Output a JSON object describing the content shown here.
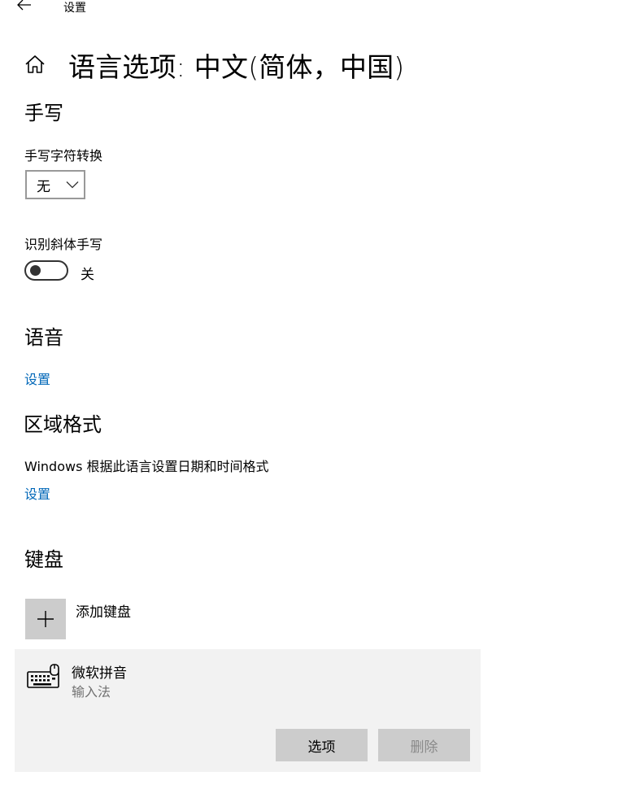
{
  "window": {
    "title": "设置",
    "back_icon": "back-arrow-icon"
  },
  "header": {
    "home_icon": "home-icon",
    "title": "语言选项: 中文(简体，中国)"
  },
  "handwriting": {
    "section_title": "手写",
    "conversion_label": "手写字符转换",
    "conversion_value": "无",
    "italic_label": "识别斜体手写",
    "italic_toggle_on": false,
    "italic_state_text": "关"
  },
  "speech": {
    "section_title": "语音",
    "settings_link": "设置"
  },
  "region": {
    "section_title": "区域格式",
    "description": "Windows 根据此语言设置日期和时间格式",
    "settings_link": "设置"
  },
  "keyboard": {
    "section_title": "键盘",
    "add_label": "添加键盘",
    "items": [
      {
        "name": "微软拼音",
        "subtitle": "输入法",
        "icon": "keyboard-icon",
        "options_label": "选项",
        "delete_label": "删除"
      }
    ]
  },
  "colors": {
    "link": "#0067b8",
    "tile": "#cccccc",
    "item_bg": "#f2f2f2",
    "disabled_text": "#8a8a8a"
  }
}
